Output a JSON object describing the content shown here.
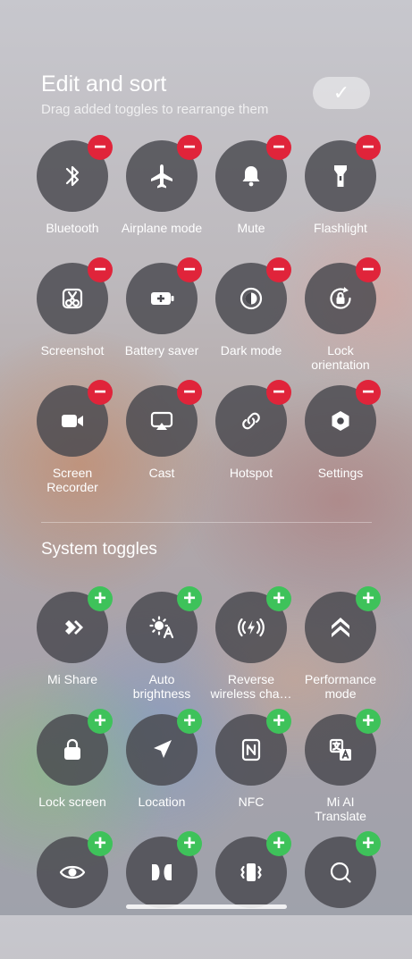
{
  "header": {
    "title": "Edit and sort",
    "subtitle": "Drag added toggles to rearrange them",
    "done_icon": "check-icon"
  },
  "added_toggles": [
    {
      "label": "Bluetooth",
      "icon": "bluetooth-icon"
    },
    {
      "label": "Airplane mode",
      "icon": "airplane-icon"
    },
    {
      "label": "Mute",
      "icon": "bell-icon"
    },
    {
      "label": "Flashlight",
      "icon": "flashlight-icon"
    },
    {
      "label": "Screenshot",
      "icon": "scissors-icon"
    },
    {
      "label": "Battery saver",
      "icon": "battery-icon"
    },
    {
      "label": "Dark mode",
      "icon": "dark-mode-icon"
    },
    {
      "label": "Lock\norientation",
      "icon": "rotation-lock-icon"
    },
    {
      "label": "Screen\nRecorder",
      "icon": "video-camera-icon"
    },
    {
      "label": "Cast",
      "icon": "cast-icon"
    },
    {
      "label": "Hotspot",
      "icon": "link-icon"
    },
    {
      "label": "Settings",
      "icon": "settings-icon"
    }
  ],
  "system_section_title": "System toggles",
  "system_toggles": [
    {
      "label": "Mi Share",
      "icon": "mi-share-icon"
    },
    {
      "label": "Auto\nbrightness",
      "icon": "auto-brightness-icon"
    },
    {
      "label": "Reverse\nwireless cha…",
      "icon": "wireless-charge-icon"
    },
    {
      "label": "Performance\nmode",
      "icon": "chevrons-up-icon"
    },
    {
      "label": "Lock screen",
      "icon": "lock-icon"
    },
    {
      "label": "Location",
      "icon": "location-arrow-icon"
    },
    {
      "label": "NFC",
      "icon": "nfc-icon"
    },
    {
      "label": "Mi AI\nTranslate",
      "icon": "translate-icon"
    },
    {
      "label": "",
      "icon": "eye-icon"
    },
    {
      "label": "",
      "icon": "dolby-icon"
    },
    {
      "label": "",
      "icon": "vibrate-icon"
    },
    {
      "label": "",
      "icon": "search-icon"
    }
  ],
  "badges": {
    "remove": "−",
    "add": "+"
  },
  "colors": {
    "remove_badge": "#e0243a",
    "add_badge": "#3ec25a",
    "tile": "#48484e"
  }
}
